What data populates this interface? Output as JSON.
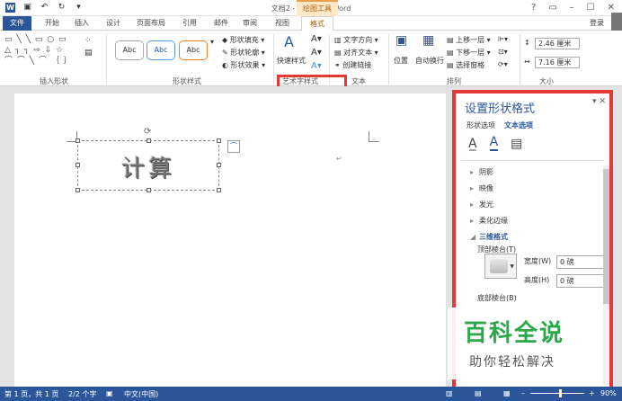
{
  "window": {
    "title": "文档2 - Microsoft Word",
    "context_tab_group": "绘图工具",
    "login": "登录",
    "win_controls": [
      "?",
      "▭",
      "–",
      "☐",
      "✕"
    ]
  },
  "tabs": [
    "文件",
    "开始",
    "插入",
    "设计",
    "页面布局",
    "引用",
    "邮件",
    "审阅",
    "视图",
    "格式"
  ],
  "ribbon": {
    "insert_shapes_label": "插入形状",
    "shape_styles_label": "形状样式",
    "style_sample": "Abc",
    "shape_fill": "形状填充",
    "shape_outline": "形状轮廓",
    "shape_effects": "形状效果",
    "quick_styles": "快速样式",
    "wordart_label": "艺术字样式",
    "text_direction": "文字方向",
    "align_text": "对齐文本",
    "create_link": "创建链接",
    "text_label": "文本",
    "position": "位置",
    "wrap_text": "自动换行",
    "bring_forward": "上移一层",
    "send_backward": "下移一层",
    "selection_pane": "选择窗格",
    "arrange_label": "排列",
    "height": "2.46 厘米",
    "width": "7.16 厘米",
    "size_label": "大小"
  },
  "document": {
    "wordart_text": "计算"
  },
  "panel": {
    "title": "设置形状格式",
    "tab_shape": "形状选项",
    "tab_text": "文本选项",
    "sections": [
      "阴影",
      "映像",
      "发光",
      "柔化边缘",
      "三维格式"
    ],
    "bevel_top": "顶部棱台(T)",
    "bevel_bottom": "底部棱台(B)",
    "width_label": "宽度(W)",
    "height_label": "高度(H)",
    "width_value": "0 磅",
    "height_value": "0 磅"
  },
  "watermark": {
    "title": "百科全说",
    "subtitle": "助你轻松解决"
  },
  "status": {
    "page": "第 1 页，共 1 页",
    "words": "2/2 个字",
    "lang": "中文(中国)",
    "zoom": "90%"
  }
}
